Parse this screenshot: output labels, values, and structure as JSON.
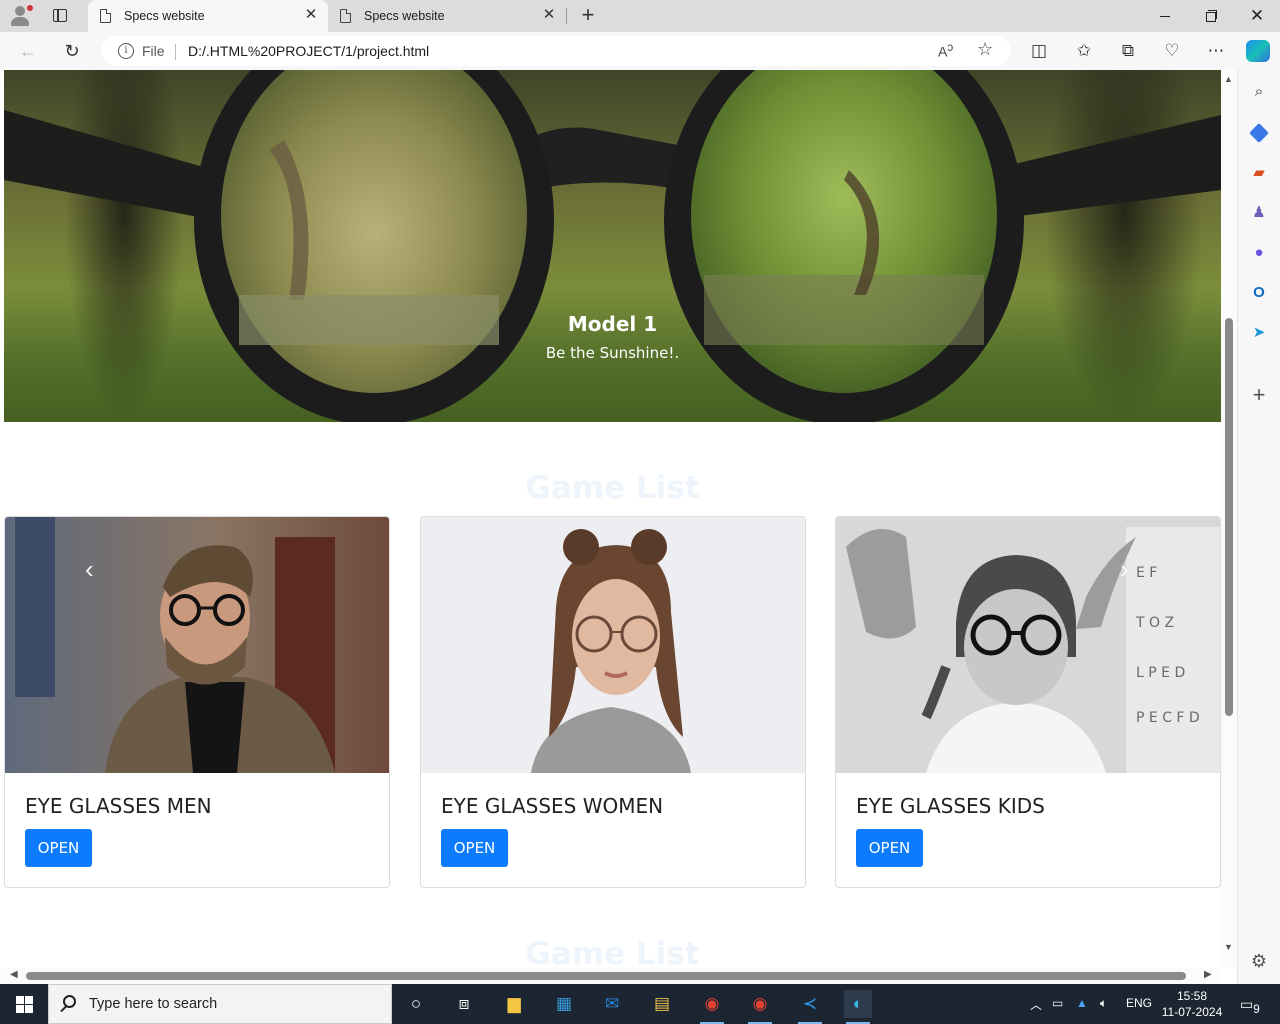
{
  "browser": {
    "tabs": [
      {
        "title": "Specs website",
        "active": true
      },
      {
        "title": "Specs website",
        "active": false
      }
    ],
    "address": {
      "scheme_label": "File",
      "url": "D:/.HTML%20PROJECT/1/project.html"
    },
    "sidebar_icons": [
      "search-icon",
      "tag-icon",
      "briefcase-icon",
      "games-icon",
      "copilot-icon",
      "outlook-icon",
      "send-icon",
      "add-icon",
      "settings-icon"
    ]
  },
  "page": {
    "hero": {
      "caption_title": "Model 1",
      "caption_text": "Be the Sunshine!."
    },
    "section_title": "Game List",
    "cards": [
      {
        "title": "EYE GLASSES MEN",
        "button": "OPEN"
      },
      {
        "title": "EYE GLASSES WOMEN",
        "button": "OPEN"
      },
      {
        "title": "EYE GLASSES KIDS",
        "button": "OPEN"
      }
    ],
    "second_section_title": "Game List"
  },
  "taskbar": {
    "search_placeholder": "Type here to search",
    "language": "ENG",
    "time": "15:58",
    "date": "11-07-2024",
    "notification_count": "9"
  },
  "colors": {
    "primary_button": "#0d7bfd",
    "section_title": "#eef4fb",
    "taskbar": "#1c2633"
  }
}
